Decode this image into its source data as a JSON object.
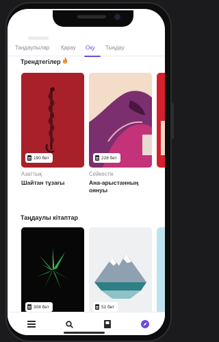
{
  "tabs": [
    {
      "label": "Таңдаулылар"
    },
    {
      "label": "Қарау"
    },
    {
      "label": "Оқу",
      "active": true
    },
    {
      "label": "Тыңдау"
    }
  ],
  "trending": {
    "title": "Трендтегілер",
    "icon": "flame-icon",
    "books": [
      {
        "pages": "190 бет",
        "author": "Азаттық",
        "title": "Шайтан тұзағы",
        "cover_color": "#a8202a"
      },
      {
        "pages": "228 бет",
        "author": "Сейкестік",
        "title": "Ана-арыстанның оянуы",
        "cover_color": "#f2d8c4"
      }
    ]
  },
  "favorites": {
    "title": "Таңдаулы кітаптар",
    "books": [
      {
        "pages": "308 бет",
        "cover_color": "#0a0a0a"
      },
      {
        "pages": "51 бет",
        "cover_color": "#e9ecef"
      }
    ]
  },
  "bottom_nav": [
    {
      "icon": "menu-icon"
    },
    {
      "icon": "search-icon"
    },
    {
      "icon": "book-icon"
    },
    {
      "icon": "compass-icon",
      "active": true
    }
  ],
  "colors": {
    "accent": "#6c4cd9",
    "flame": "#ee7a1e"
  }
}
